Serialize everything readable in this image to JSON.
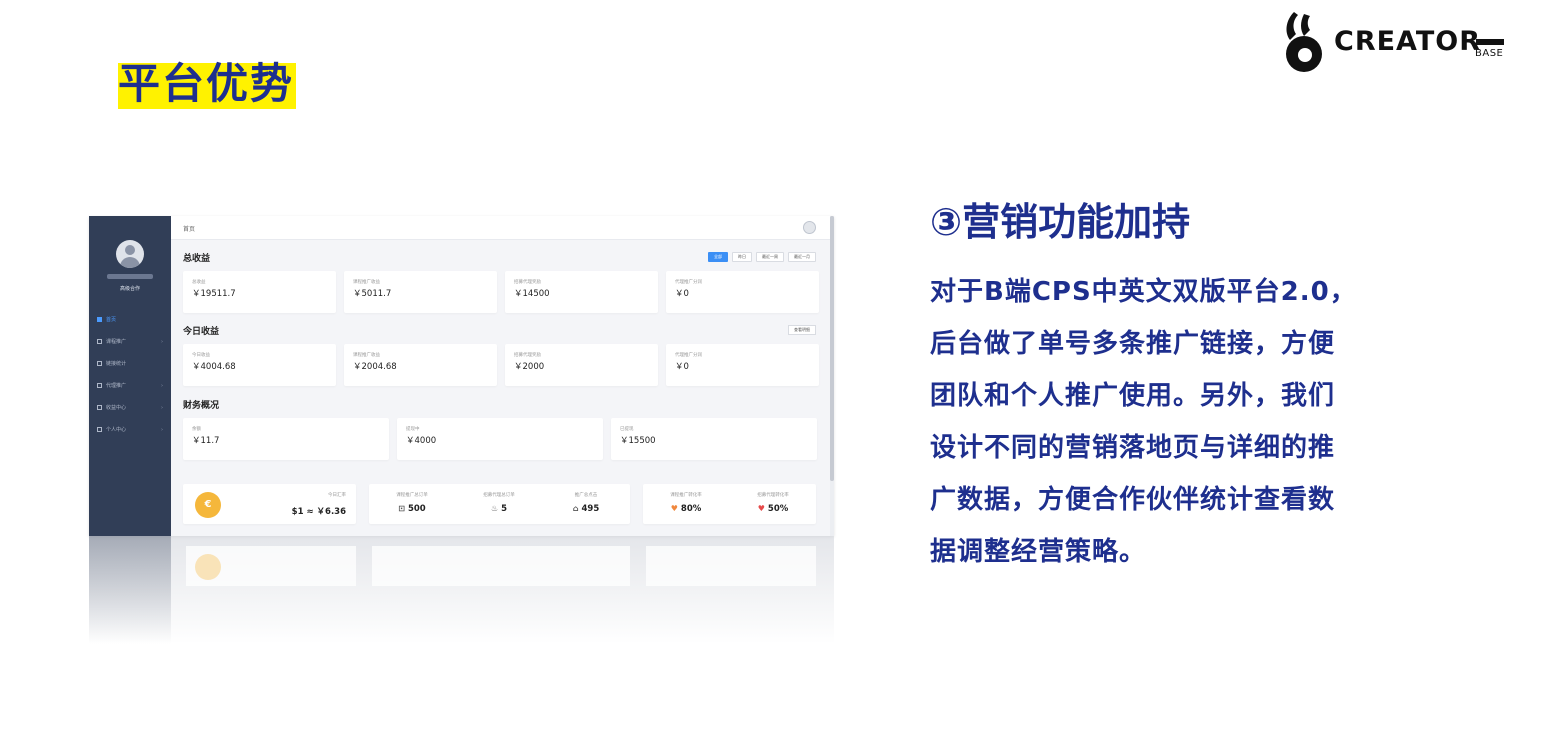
{
  "slide": {
    "title": "平台优势",
    "logo": {
      "word": "CREATOR",
      "sub": "BASE"
    },
    "feature_title": "③营销功能加持",
    "feature_lines": [
      "对于B端CPS中英文双版平台2.0，",
      "后台做了单号多条推广链接，方便",
      "团队和个人推广使用。另外，我们",
      "设计不同的营销落地页与详细的推",
      "广数据，方便合作伙伴统计查看数",
      "据调整经营策略。"
    ]
  },
  "admin": {
    "breadcrumb": "首页",
    "sidebar": {
      "role": "高级合作",
      "items": [
        {
          "label": "首页"
        },
        {
          "label": "课程推广"
        },
        {
          "label": "链接统计"
        },
        {
          "label": "代理推广"
        },
        {
          "label": "收益中心"
        },
        {
          "label": "个人中心"
        }
      ]
    },
    "total_income": {
      "title": "总收益",
      "filters": [
        "全部",
        "昨日",
        "最近一周",
        "最近一月"
      ],
      "cards": [
        {
          "label": "总收益",
          "value": "￥19511.7"
        },
        {
          "label": "课程推广收益",
          "value": "￥5011.7"
        },
        {
          "label": "招募代理奖励",
          "value": "￥14500"
        },
        {
          "label": "代理推广分润",
          "value": "￥0"
        }
      ]
    },
    "today_income": {
      "title": "今日收益",
      "more": "查看明细",
      "cards": [
        {
          "label": "今日收益",
          "value": "￥4004.68"
        },
        {
          "label": "课程推广收益",
          "value": "￥2004.68"
        },
        {
          "label": "招募代理奖励",
          "value": "￥2000"
        },
        {
          "label": "代理推广分润",
          "value": "￥0"
        }
      ]
    },
    "finance": {
      "title": "财务概况",
      "cards": [
        {
          "label": "余额",
          "value": "￥11.7"
        },
        {
          "label": "提现中",
          "value": "￥4000"
        },
        {
          "label": "已提现",
          "value": "￥15500"
        }
      ]
    },
    "exchange": {
      "label": "今日汇率",
      "value": "$1 ≈ ￥6.36",
      "coin": "€"
    },
    "stats": [
      {
        "label": "课程推广总订单",
        "value": "500",
        "icon": "⊡"
      },
      {
        "label": "招募代理总订单",
        "value": "5",
        "icon": "♨"
      },
      {
        "label": "推广总点击",
        "value": "495",
        "icon": "⌂"
      }
    ],
    "rates": [
      {
        "label": "课程推广转化率",
        "value": "80%",
        "icon": "♥",
        "color": "#f0883e"
      },
      {
        "label": "招募代理转化率",
        "value": "50%",
        "icon": "♥",
        "color": "#e64a4a"
      }
    ]
  }
}
